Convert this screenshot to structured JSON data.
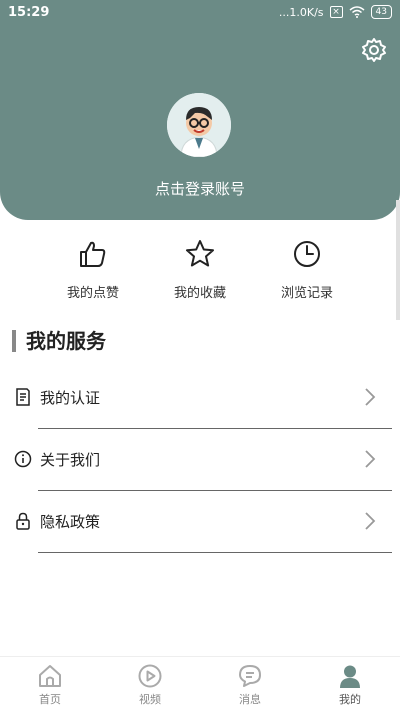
{
  "status_bar": {
    "time": "15:29",
    "network_speed": "...1.0K/s",
    "x_icon": "x-box-icon",
    "wifi_icon": "wifi-icon",
    "battery": "43"
  },
  "header": {
    "login_text": "点击登录账号",
    "avatar_icon": "doctor-avatar-icon",
    "settings_icon": "gear-icon"
  },
  "quick_actions": [
    {
      "label": "我的点赞",
      "icon": "thumbs-up-icon"
    },
    {
      "label": "我的收藏",
      "icon": "star-icon"
    },
    {
      "label": "浏览记录",
      "icon": "clock-icon"
    }
  ],
  "services": {
    "title": "我的服务",
    "items": [
      {
        "label": "我的认证",
        "icon": "document-edit-icon"
      },
      {
        "label": "关于我们",
        "icon": "info-icon"
      },
      {
        "label": "隐私政策",
        "icon": "lock-icon"
      }
    ]
  },
  "tabs": [
    {
      "label": "首页",
      "icon": "home-icon"
    },
    {
      "label": "视频",
      "icon": "play-icon"
    },
    {
      "label": "消息",
      "icon": "chat-icon"
    },
    {
      "label": "我的",
      "icon": "person-icon",
      "active": true
    }
  ],
  "colors": {
    "header_bg": "#6b8b86",
    "active_tab": "#6b8b86"
  }
}
